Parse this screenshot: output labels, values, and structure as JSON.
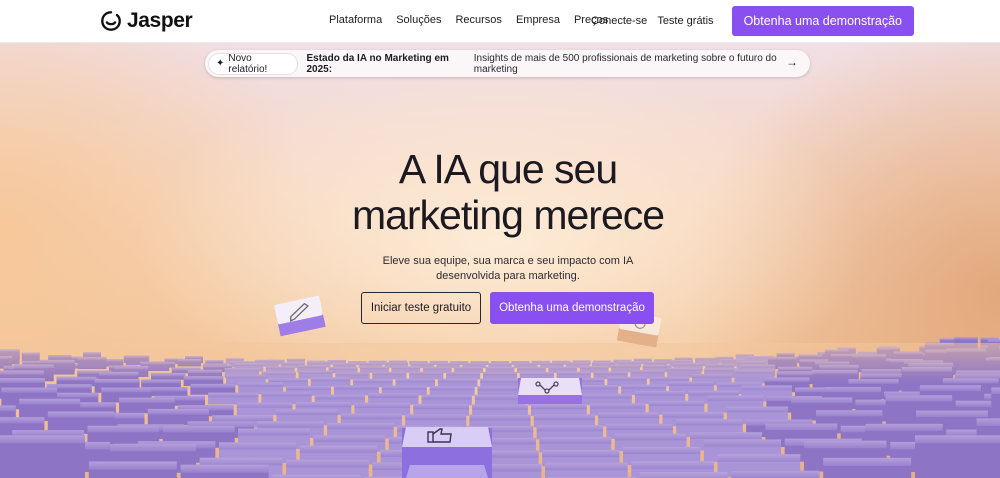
{
  "brand": {
    "name": "Jasper"
  },
  "nav": {
    "menu": [
      {
        "label": "Plataforma"
      },
      {
        "label": "Soluções"
      },
      {
        "label": "Recursos"
      },
      {
        "label": "Empresa"
      },
      {
        "label": "Preços"
      }
    ],
    "login_label": "Conecte-se",
    "trial_label": "Teste grátis",
    "demo_label": "Obtenha uma demonstração"
  },
  "banner": {
    "badge": "Novo relatório!",
    "title": "Estado da IA no Marketing em 2025:",
    "text": "Insights de mais de 500 profissionais de marketing sobre o futuro do marketing"
  },
  "hero": {
    "title_line1": "A IA que seu",
    "title_line2": "marketing merece",
    "subtitle": "Eleve sua equipe, sua marca e seu impacto com IA desenvolvida para marketing.",
    "primary_label": "Iniciar teste gratuito",
    "secondary_label": "Obtenha uma demonstração"
  },
  "colors": {
    "accent": "#8a4ff0",
    "tile_purple": "#8d74c4",
    "text": "#1c1a20"
  },
  "icons": [
    "jasper-logo-icon",
    "sparkle-icon",
    "arrow-right-icon",
    "pencil-icon",
    "thumbs-up-icon",
    "share-icon",
    "pen-nib-icon"
  ]
}
